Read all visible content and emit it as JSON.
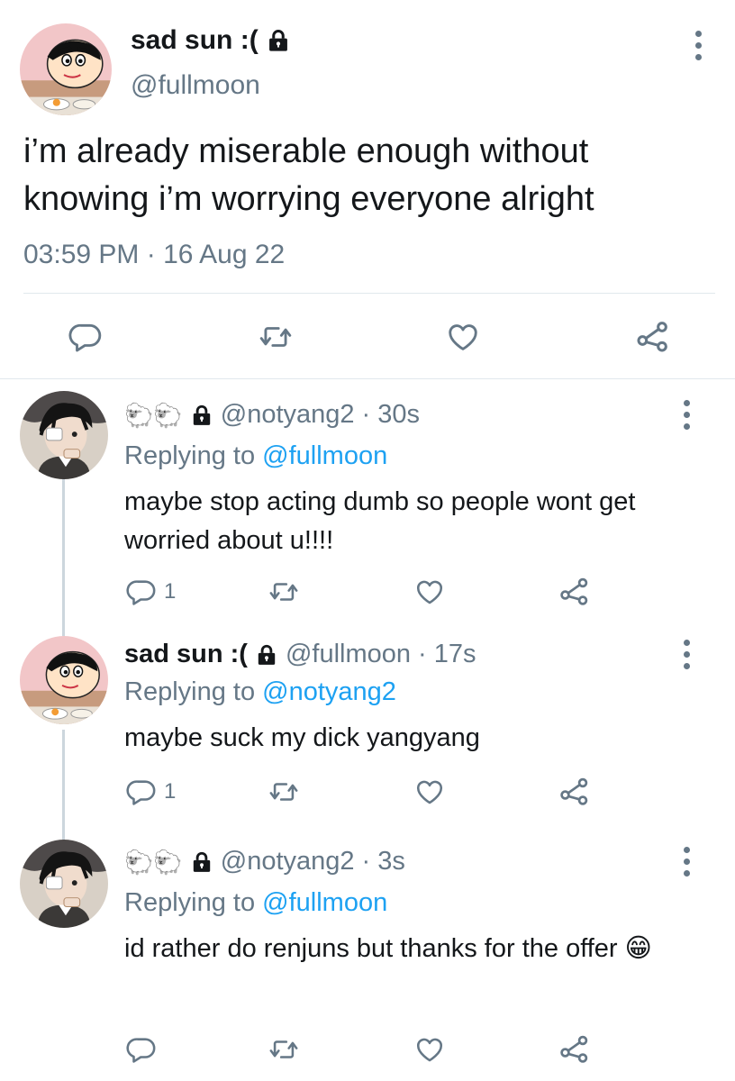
{
  "main": {
    "name": "sad sun :(",
    "handle": "@fullmoon",
    "text": "i’m already miserable enough without knowing i’m worrying everyone alright",
    "time": "03:59 PM",
    "sep": "·",
    "date": "16 Aug 22"
  },
  "replies": [
    {
      "name_emoji": "🐑🐑",
      "handle": "@notyang2",
      "sep": "·",
      "time": "30s",
      "replying_label": "Replying to",
      "replying_to": "@fullmoon",
      "text": "maybe stop acting dumb so people wont get worried about u!!!!",
      "reply_count": "1"
    },
    {
      "name": "sad sun :(",
      "handle": "@fullmoon",
      "sep": "·",
      "time": "17s",
      "replying_label": "Replying to",
      "replying_to": "@notyang2",
      "text": "maybe suck my dick yangyang",
      "reply_count": "1"
    },
    {
      "name_emoji": "🐑🐑",
      "handle": "@notyang2",
      "sep": "·",
      "time": "3s",
      "replying_label": "Replying to",
      "replying_to": "@fullmoon",
      "text": "id rather do renjuns but thanks for the offer",
      "text_emoji": "😁"
    }
  ],
  "colors": {
    "text": "#14171a",
    "secondary": "#657786",
    "link": "#1da1f2",
    "divider": "#e1e8ed"
  },
  "icons": [
    "lock-icon",
    "more-icon",
    "reply-icon",
    "retweet-icon",
    "like-icon",
    "share-icon"
  ]
}
